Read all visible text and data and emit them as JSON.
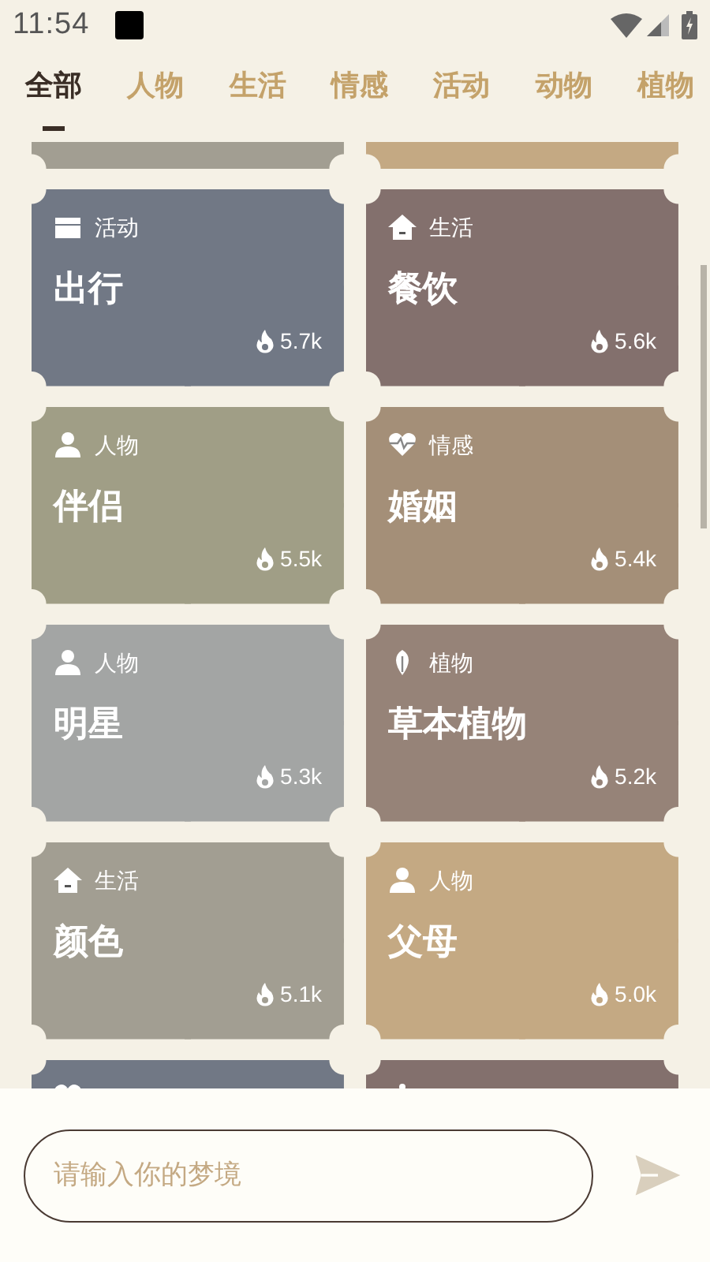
{
  "status_bar": {
    "time": "11:54"
  },
  "tabs": [
    {
      "label": "全部",
      "selected": true
    },
    {
      "label": "人物",
      "selected": false
    },
    {
      "label": "生活",
      "selected": false
    },
    {
      "label": "情感",
      "selected": false
    },
    {
      "label": "活动",
      "selected": false
    },
    {
      "label": "动物",
      "selected": false
    },
    {
      "label": "植物",
      "selected": false
    }
  ],
  "top_partial_cards": [
    {
      "color": "#a29e92"
    },
    {
      "color": "#c4a983"
    }
  ],
  "cards": [
    {
      "kind": "activity",
      "category": "活动",
      "title": "出行",
      "count": "5.7k",
      "color": "#717885"
    },
    {
      "kind": "life",
      "category": "生活",
      "title": "餐饮",
      "count": "5.6k",
      "color": "#83706d"
    },
    {
      "kind": "person",
      "category": "人物",
      "title": "伴侣",
      "count": "5.5k",
      "color": "#a09e86"
    },
    {
      "kind": "emotion",
      "category": "情感",
      "title": "婚姻",
      "count": "5.4k",
      "color": "#a48f78"
    },
    {
      "kind": "person",
      "category": "人物",
      "title": "明星",
      "count": "5.3k",
      "color": "#a3a5a4"
    },
    {
      "kind": "plant",
      "category": "植物",
      "title": "草本植物",
      "count": "5.2k",
      "color": "#968378"
    },
    {
      "kind": "life",
      "category": "生活",
      "title": "颜色",
      "count": "5.1k",
      "color": "#a29e92"
    },
    {
      "kind": "person",
      "category": "人物",
      "title": "父母",
      "count": "5.0k",
      "color": "#c4a983"
    }
  ],
  "bottom_partial_cards": [
    {
      "kind": "emotion",
      "color": "#717885"
    },
    {
      "kind": "animal",
      "color": "#83706d"
    }
  ],
  "input": {
    "placeholder": "请输入你的梦境"
  }
}
